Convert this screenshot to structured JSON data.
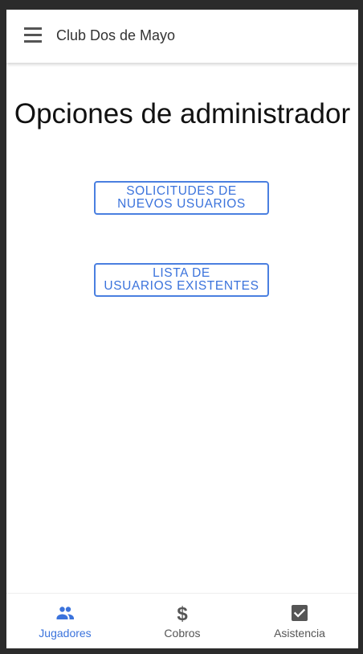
{
  "app": {
    "title": "Club Dos de Mayo"
  },
  "main": {
    "heading": "Opciones de administrador",
    "buttons": [
      {
        "line1": "SOLICITUDES DE",
        "line2": "NUEVOS USUARIOS"
      },
      {
        "line1": "LISTA DE",
        "line2": "USUARIOS EXISTENTES"
      }
    ]
  },
  "bottom_nav": {
    "items": [
      {
        "label": "Jugadores",
        "icon": "people-icon",
        "active": true
      },
      {
        "label": "Cobros",
        "icon": "dollar-icon",
        "active": false
      },
      {
        "label": "Asistencia",
        "icon": "checkbox-icon",
        "active": false
      }
    ]
  },
  "colors": {
    "accent": "#3b73dc",
    "inactive": "#555555",
    "background": "#ffffff",
    "outer": "#2b2b2b"
  }
}
